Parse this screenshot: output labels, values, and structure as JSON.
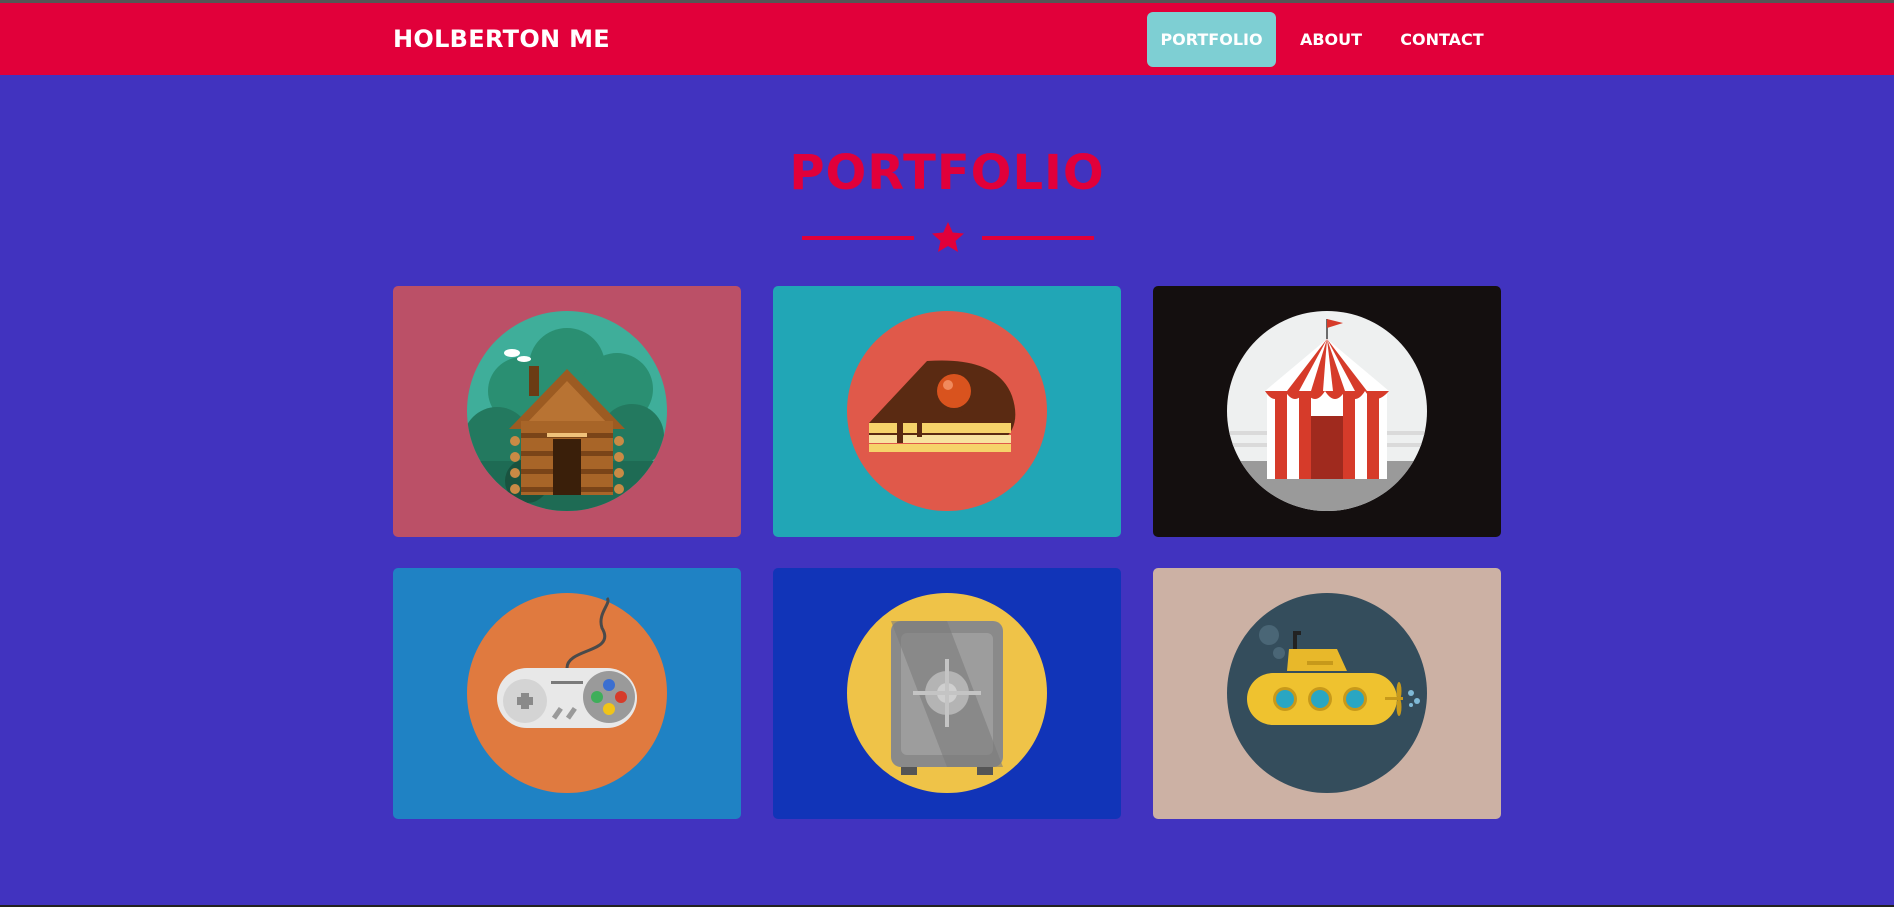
{
  "navbar": {
    "brand": "HOLBERTON ME",
    "links": [
      {
        "label": "PORTFOLIO",
        "active": true
      },
      {
        "label": "ABOUT",
        "active": false
      },
      {
        "label": "CONTACT",
        "active": false
      }
    ]
  },
  "section": {
    "title": "PORTFOLIO",
    "divider_icon": "star-icon"
  },
  "portfolio": {
    "items": [
      {
        "icon": "log-cabin-icon",
        "bg": "#bb5067"
      },
      {
        "icon": "cake-slice-icon",
        "bg": "#21a6b6"
      },
      {
        "icon": "circus-tent-icon",
        "bg": "#140f0f"
      },
      {
        "icon": "game-controller-icon",
        "bg": "#1f82c4"
      },
      {
        "icon": "safe-icon",
        "bg": "#1134b8"
      },
      {
        "icon": "submarine-icon",
        "bg": "#ccb1a4"
      }
    ]
  },
  "colors": {
    "page_bg": "#4133bf",
    "navbar_bg": "#e1003a",
    "accent": "#e1003a",
    "active_link_bg": "#7ecfd3"
  }
}
